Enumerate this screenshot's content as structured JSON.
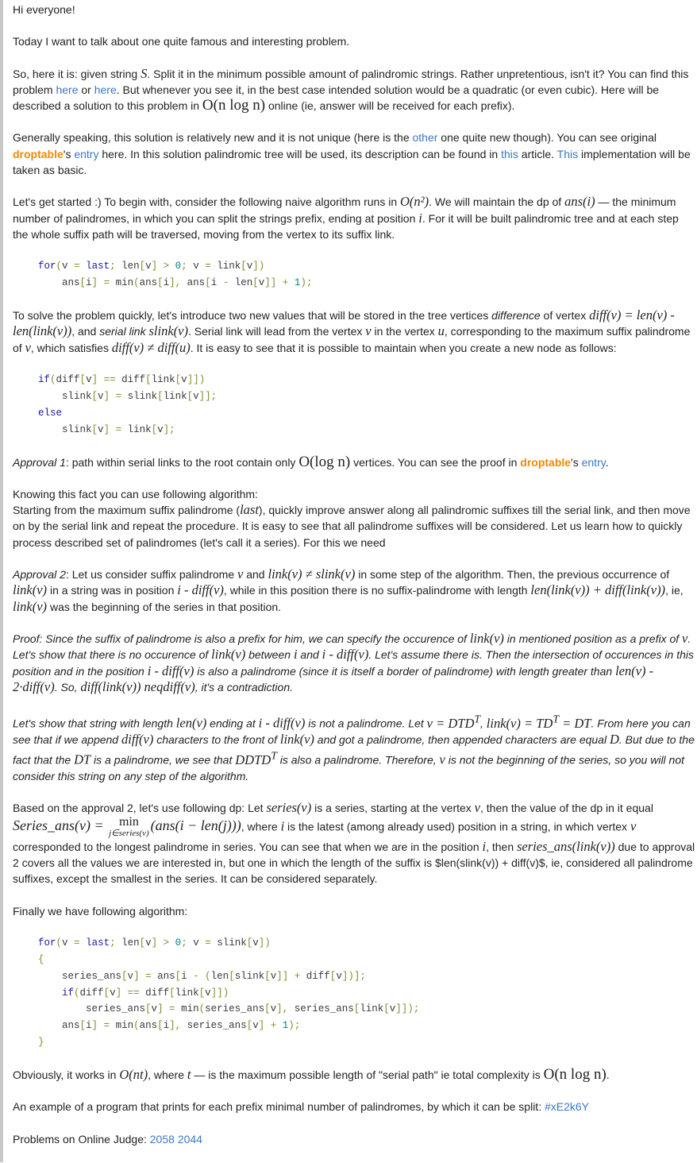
{
  "p_greeting": "Hi everyone!",
  "p_intro": "Today I want to talk about one quite famous and interesting problem.",
  "p_problem": {
    "t1": "So, here it is: given string ",
    "m_S": "S",
    "t2": ". Split it in the minimum possible amount of palindromic strings. Rather unpretentious, isn't it? You can find this problem ",
    "link1": "here",
    "t3": " or ",
    "link2": "here",
    "t4": ". But whenever you see it, in the best case intended solution would be a quadratic (or even cubic). Here will be described a solution to this problem in ",
    "m_cx": "O(n log n)",
    "t5": " online (ie, answer will be received for each prefix)."
  },
  "p_general": {
    "t1": "Generally speaking, this solution is relatively new and it is not unique (here is the ",
    "link_other": "other",
    "t2": " one quite new though). You can see original ",
    "user": "droptable",
    "t3": "'s ",
    "link_entry": "entry",
    "t4": " here. In this solution palindromic tree will be used, its description can be found in ",
    "link_this1": "this",
    "t5": " article. ",
    "link_this2": "This",
    "t6": " implementation will be taken as basic."
  },
  "p_start": {
    "t1": "Let's get started :) To begin with, consider the following naive algorithm runs in ",
    "m1": "O(n²)",
    "t2": ". We will maintain the dp of ",
    "m2": "ans(i)",
    "t3": " — the minimum number of palindromes, in which you can split the strings prefix, ending at position ",
    "m3": "i",
    "t4": ". For it will be built palindromic tree and at each step the whole suffix path will be traversed, moving from the vertex to its suffix link."
  },
  "code1": [
    [
      [
        "kw",
        "for"
      ],
      [
        "pun",
        "("
      ],
      [
        "",
        "v "
      ],
      [
        "op",
        "="
      ],
      [
        "kw",
        " last"
      ],
      [
        "pun",
        ";"
      ],
      [
        "",
        " len"
      ],
      [
        "pun",
        "["
      ],
      [
        "",
        "v"
      ],
      [
        "pun",
        "]"
      ],
      [
        "op",
        " >"
      ],
      [
        "num",
        " 0"
      ],
      [
        "pun",
        ";"
      ],
      [
        "",
        " v "
      ],
      [
        "op",
        "="
      ],
      [
        "",
        " link"
      ],
      [
        "pun",
        "["
      ],
      [
        "",
        "v"
      ],
      [
        "pun",
        "])"
      ]
    ],
    [
      [
        "",
        "    ans"
      ],
      [
        "pun",
        "["
      ],
      [
        "",
        "i"
      ],
      [
        "pun",
        "]"
      ],
      [
        "op",
        " ="
      ],
      [
        "",
        " min"
      ],
      [
        "pun",
        "("
      ],
      [
        "",
        "ans"
      ],
      [
        "pun",
        "["
      ],
      [
        "",
        "i"
      ],
      [
        "pun",
        "],"
      ],
      [
        "",
        " ans"
      ],
      [
        "pun",
        "["
      ],
      [
        "",
        "i "
      ],
      [
        "op",
        "-"
      ],
      [
        "",
        " len"
      ],
      [
        "pun",
        "["
      ],
      [
        "",
        "v"
      ],
      [
        "pun",
        "]]"
      ],
      [
        "op",
        " +"
      ],
      [
        "num",
        " 1"
      ],
      [
        "pun",
        ");"
      ]
    ]
  ],
  "p_solve": {
    "t1": "To solve the problem quickly, let's introduce two new values that will be stored in the tree vertices ",
    "e1": "difference",
    "t2": " of vertex ",
    "m1": "diff(v) = len(v) - len(link(v))",
    "t3": ", and ",
    "e2": "serial link",
    "t4": " ",
    "m2": "slink(v)",
    "t5": ". Serial link will lead from the vertex ",
    "m3": "v",
    "t6": " in the vertex ",
    "m4": "u",
    "t7": ", corresponding to the maximum suffix palindrome of ",
    "m5": "v",
    "t8": ", which satisfies ",
    "m6": "diff(v) ≠ diff(u)",
    "t9": ". It is easy to see that it is possible to maintain when you create a new node as follows:"
  },
  "code2": [
    [
      [
        "kw",
        "if"
      ],
      [
        "pun",
        "("
      ],
      [
        "",
        "diff"
      ],
      [
        "pun",
        "["
      ],
      [
        "",
        "v"
      ],
      [
        "pun",
        "]"
      ],
      [
        "op",
        " =="
      ],
      [
        "",
        " diff"
      ],
      [
        "pun",
        "["
      ],
      [
        "",
        "link"
      ],
      [
        "pun",
        "["
      ],
      [
        "",
        "v"
      ],
      [
        "pun",
        "]])"
      ]
    ],
    [
      [
        "",
        "    slink"
      ],
      [
        "pun",
        "["
      ],
      [
        "",
        "v"
      ],
      [
        "pun",
        "]"
      ],
      [
        "op",
        " ="
      ],
      [
        "",
        " slink"
      ],
      [
        "pun",
        "["
      ],
      [
        "",
        "link"
      ],
      [
        "pun",
        "["
      ],
      [
        "",
        "v"
      ],
      [
        "pun",
        "]];"
      ]
    ],
    [
      [
        "kw",
        "else"
      ]
    ],
    [
      [
        "",
        "    slink"
      ],
      [
        "pun",
        "["
      ],
      [
        "",
        "v"
      ],
      [
        "pun",
        "]"
      ],
      [
        "op",
        " ="
      ],
      [
        "",
        " link"
      ],
      [
        "pun",
        "["
      ],
      [
        "",
        "v"
      ],
      [
        "pun",
        "];"
      ]
    ]
  ],
  "p_appr1": {
    "e1": "Approval 1",
    "t1": ": path within serial links to the root contain only ",
    "m1": "O(log n)",
    "t2": " vertices. You can see the proof in ",
    "user": "droptable",
    "t3": "'s ",
    "link": "entry",
    "t4": "."
  },
  "p_know": {
    "t1": "Knowing this fact you can use following algorithm:",
    "t2": "Starting from the maximum suffix palindrome (",
    "m1": "last",
    "t3": "), quickly improve answer along all palindromic suffixes till the serial link, and then move on by the serial link and repeat the procedure. It is easy to see that all palindrome suffixes will be considered. Let us learn how to quickly process described set of palindromes (let's call it a series). For this we need"
  },
  "p_appr2": {
    "e1": "Approval 2",
    "t1": ": Let us consider suffix palindrome ",
    "m1": "v",
    "t2": " and ",
    "m2": "link(v) ≠ slink(v)",
    "t3": " in some step of the algorithm. Then, the previous occurrence of ",
    "m3": "link(v)",
    "t4": " in a string was in position ",
    "m4": "i - diff(v)",
    "t5": ", while in this position there is no suffix-palindrome with length ",
    "m5": "len(link(v)) + diff(link(v))",
    "t6": ", ie, ",
    "m6": "link(v)",
    "t7": " was the beginning of the series in that position."
  },
  "p_proof1": {
    "t1": "Proof: Since the suffix of palindrome is also a prefix for him, we can specify the occurence of ",
    "m1": "link(v)",
    "t2": " in mentioned position as a prefix of ",
    "m2": "v",
    "t3": ". Let's show that there is no occurence of ",
    "m3": "link(v)",
    "t4": " between ",
    "m4": "i",
    "t5": " and ",
    "m5": "i - diff(v)",
    "t6": ". Let's assume there is. Then the intersection of occurences in this position and in the position ",
    "m6": "i - diff(v)",
    "t7": " is also a palindrome (since it is itself a border of palindrome) with length greater than ",
    "m7": "len(v) - 2·diff(v)",
    "t8": ". So, ",
    "m8": "diff(link(v)) neqdiff(v)",
    "t9": ", it's a contradiction."
  },
  "p_proof2": {
    "t1": "Let's show that string with length ",
    "m1": "len(v)",
    "t2": " ending at ",
    "m2": "i - diff(v)",
    "t3": " is not a palindrome. Let ",
    "m3": "v = DTD",
    "s3": "T",
    "t4": ", ",
    "m4": "link(v) = TD",
    "s4": "T",
    "m4b": " = DT",
    "t5": ". From here you can see that if we append ",
    "m5": "diff(v)",
    "t6": " characters to the front of ",
    "m6": "link(v)",
    "t7": " and got a palindrome, then appended characters are equal ",
    "m7": "D",
    "t8": ". But due to the fact that the ",
    "m8": "DT",
    "t9": " is a palindrome, we see that ",
    "m9": "DDTD",
    "s9": "T",
    "t10": " is also a palindrome. Therefore, ",
    "m10": "v",
    "t11": " is not the beginning of the series, so you will not consider this string on any step of the algorithm."
  },
  "p_dp": {
    "t1": "Based on the approval 2, let's use following dp: Let ",
    "m1": "series(v)",
    "t2": " is a series, starting at the vertex ",
    "m2": "v",
    "t3": ", then the value of the dp in it equal ",
    "f_left": "Series_ans(v) = ",
    "f_min": "min",
    "f_sub": "j∈series(v)",
    "f_right": "(ans(i − len(j)))",
    "t4": ", where ",
    "m3": "i",
    "t5": " is the latest (among already used) position in a string, in which vertex ",
    "m4": "v",
    "t6": " corresponded to the longest palindrome in series. You can see that when we are in the position ",
    "m5": "i",
    "t7": ", then ",
    "m6": "series_ans(link(v))",
    "t8": " due to approval 2 covers all the values we are interested in, but one in which the length of the suffix is $len(slink(v)) + diff(v)$, ie, considered all palindrome suffixes, except the smallest in the series. It can be considered separately."
  },
  "p_finally": "Finally we have following algorithm:",
  "code3": [
    [
      [
        "kw",
        "for"
      ],
      [
        "pun",
        "("
      ],
      [
        "",
        "v "
      ],
      [
        "op",
        "="
      ],
      [
        "kw",
        " last"
      ],
      [
        "pun",
        ";"
      ],
      [
        "",
        " len"
      ],
      [
        "pun",
        "["
      ],
      [
        "",
        "v"
      ],
      [
        "pun",
        "]"
      ],
      [
        "op",
        " >"
      ],
      [
        "num",
        " 0"
      ],
      [
        "pun",
        ";"
      ],
      [
        "",
        " v "
      ],
      [
        "op",
        "="
      ],
      [
        "",
        " slink"
      ],
      [
        "pun",
        "["
      ],
      [
        "",
        "v"
      ],
      [
        "pun",
        "])"
      ]
    ],
    [
      [
        "pun",
        "{"
      ]
    ],
    [
      [
        "",
        "    series_ans"
      ],
      [
        "pun",
        "["
      ],
      [
        "",
        "v"
      ],
      [
        "pun",
        "]"
      ],
      [
        "op",
        " ="
      ],
      [
        "",
        " ans"
      ],
      [
        "pun",
        "["
      ],
      [
        "",
        "i "
      ],
      [
        "op",
        "-"
      ],
      [
        "pun",
        " ("
      ],
      [
        "",
        "len"
      ],
      [
        "pun",
        "["
      ],
      [
        "",
        "slink"
      ],
      [
        "pun",
        "["
      ],
      [
        "",
        "v"
      ],
      [
        "pun",
        "]]"
      ],
      [
        "op",
        " +"
      ],
      [
        "",
        " diff"
      ],
      [
        "pun",
        "["
      ],
      [
        "",
        "v"
      ],
      [
        "pun",
        "])];"
      ]
    ],
    [
      [
        "kw",
        "    if"
      ],
      [
        "pun",
        "("
      ],
      [
        "",
        "diff"
      ],
      [
        "pun",
        "["
      ],
      [
        "",
        "v"
      ],
      [
        "pun",
        "]"
      ],
      [
        "op",
        " =="
      ],
      [
        "",
        " diff"
      ],
      [
        "pun",
        "["
      ],
      [
        "",
        "link"
      ],
      [
        "pun",
        "["
      ],
      [
        "",
        "v"
      ],
      [
        "pun",
        "]])"
      ]
    ],
    [
      [
        "",
        "        series_ans"
      ],
      [
        "pun",
        "["
      ],
      [
        "",
        "v"
      ],
      [
        "pun",
        "]"
      ],
      [
        "op",
        " ="
      ],
      [
        "",
        " min"
      ],
      [
        "pun",
        "("
      ],
      [
        "",
        "series_ans"
      ],
      [
        "pun",
        "["
      ],
      [
        "",
        "v"
      ],
      [
        "pun",
        "],"
      ],
      [
        "",
        " series_ans"
      ],
      [
        "pun",
        "["
      ],
      [
        "",
        "link"
      ],
      [
        "pun",
        "["
      ],
      [
        "",
        "v"
      ],
      [
        "pun",
        "]]);"
      ]
    ],
    [
      [
        "",
        "    ans"
      ],
      [
        "pun",
        "["
      ],
      [
        "",
        "i"
      ],
      [
        "pun",
        "]"
      ],
      [
        "op",
        " ="
      ],
      [
        "",
        " min"
      ],
      [
        "pun",
        "("
      ],
      [
        "",
        "ans"
      ],
      [
        "pun",
        "["
      ],
      [
        "",
        "i"
      ],
      [
        "pun",
        "],"
      ],
      [
        "",
        " series_ans"
      ],
      [
        "pun",
        "["
      ],
      [
        "",
        "v"
      ],
      [
        "pun",
        "]"
      ],
      [
        "op",
        " +"
      ],
      [
        "num",
        " 1"
      ],
      [
        "pun",
        ");"
      ]
    ],
    [
      [
        "pun",
        "}"
      ]
    ]
  ],
  "p_obv": {
    "t1": "Obviously, it works in ",
    "m1": "O(nt)",
    "t2": ", where ",
    "m2": "t",
    "t3": " — is the maximum possible length of \"serial path\" ie total complexity is ",
    "m3": "O(n log n)",
    "t4": "."
  },
  "p_example": {
    "t1": "An example of a program that prints for each prefix minimal number of palindromes, by which it can be split: ",
    "link": "#xE2k6Y"
  },
  "p_problems": {
    "t1": "Problems on Online Judge: ",
    "link1": "2058",
    "link2": "2044"
  }
}
